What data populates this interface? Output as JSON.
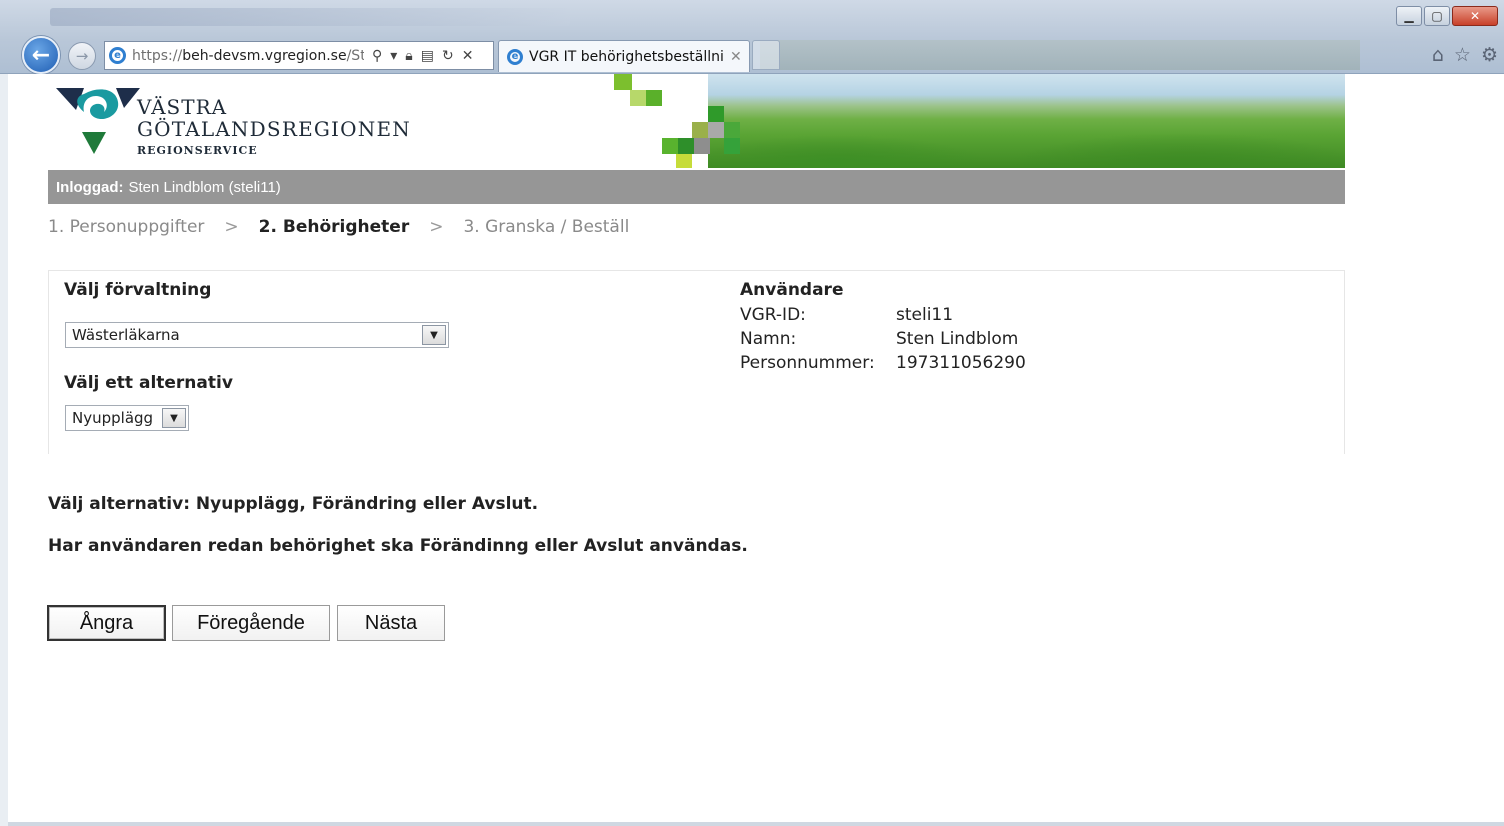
{
  "browser": {
    "url_prefix": "https://",
    "url_host": "beh-devsm.vgregion.se",
    "url_path": "/Ste",
    "tab_title": "VGR IT behörighetsbeställni...",
    "window_controls": [
      "minimize-icon",
      "maximize-icon",
      "close-icon"
    ],
    "toolbar_icons": [
      "home-icon",
      "star-icon",
      "gear-icon"
    ]
  },
  "header": {
    "logo_line1": "VÄSTRA",
    "logo_line2": "GÖTALANDSREGIONEN",
    "logo_line3": "REGIONSERVICE",
    "logo_colors": {
      "teal": "#1a9aa0",
      "green": "#1f7a3a",
      "navy": "#1e2e4a"
    }
  },
  "login": {
    "label": "Inloggad:",
    "user": "Sten Lindblom (steli11)"
  },
  "steps": [
    {
      "label": "1. Personuppgifter",
      "active": false
    },
    {
      "label": "2. Behörigheter",
      "active": true
    },
    {
      "label": "3. Granska / Beställ",
      "active": false
    }
  ],
  "steps_separator": ">",
  "form": {
    "forvaltning_label": "Välj förvaltning",
    "forvaltning_value": "Wästerläkarna",
    "alternativ_label": "Välj ett alternativ",
    "alternativ_value": "Nyupplägg"
  },
  "user": {
    "title": "Användare",
    "rows": [
      {
        "key": "VGR-ID:",
        "value": "steli11"
      },
      {
        "key": "Namn:",
        "value": "Sten Lindblom"
      },
      {
        "key": "Personnummer:",
        "value": "197311056290"
      }
    ]
  },
  "messages": {
    "line1": "Välj alternativ: Nyupplägg, Förändring eller Avslut.",
    "line2": "Har användaren redan behörighet ska Förändinng eller Avslut användas."
  },
  "buttons": {
    "cancel": "Ångra",
    "previous": "Föregående",
    "next": "Nästa"
  },
  "colors": {
    "login_bar": "#969696",
    "banner_green": "#5aa434"
  }
}
